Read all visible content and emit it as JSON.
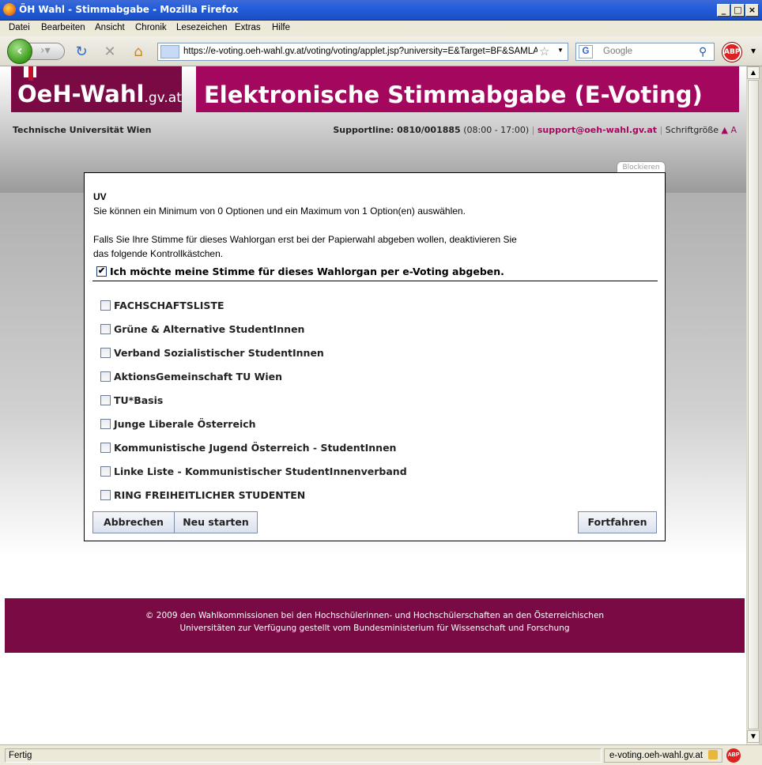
{
  "window": {
    "title": "ÖH Wahl - Stimmabgabe - Mozilla Firefox"
  },
  "menu": {
    "items": [
      "Datei",
      "Bearbeiten",
      "Ansicht",
      "Chronik",
      "Lesezeichen",
      "Extras",
      "Hilfe"
    ]
  },
  "toolbar": {
    "url": "https://e-voting.oeh-wahl.gv.at/voting/voting/applet.jsp?university=E&Target=BF&SAMLAr",
    "search_placeholder": "Google",
    "adblock_label": "ABP"
  },
  "header": {
    "logo_text": "OeH-Wahl",
    "logo_suffix": ".gv.at",
    "banner": "Elektronische Stimmabgabe (E-Voting)",
    "university": "Technische Universität Wien",
    "support_label": "Supportline: 0810/001885",
    "support_hours": "(08:00 - 17:00)",
    "support_sep1": "|",
    "support_email": "support@oeh-wahl.gv.at",
    "support_sep2": "|",
    "font_size_label": "Schriftgröße",
    "font_size_controls": "▲ A"
  },
  "panel": {
    "tab_label": "Blockieren",
    "title": "UV",
    "min_max_text": "Sie können ein Minimum von 0 Optionen und ein Maximum von 1 Option(en) auswählen.",
    "paper_text_1": "Falls Sie Ihre Stimme für dieses Wahlorgan erst bei der Papierwahl abgeben wollen, deaktivieren Sie",
    "paper_text_2": "das folgende Kontrollkästchen.",
    "confirm_label": "Ich möchte meine Stimme für dieses Wahlorgan per e-Voting abgeben.",
    "confirm_checked": true,
    "options": [
      "FACHSCHAFTSLISTE",
      "Grüne & Alternative StudentInnen",
      "Verband Sozialistischer StudentInnen",
      "AktionsGemeinschaft TU Wien",
      "TU*Basis",
      "Junge Liberale Österreich",
      "Kommunistische Jugend Österreich - StudentInnen",
      "Linke Liste - Kommunistischer StudentInnenverband",
      "RING FREIHEITLICHER STUDENTEN"
    ],
    "buttons": {
      "cancel": "Abbrechen",
      "restart": "Neu starten",
      "continue": "Fortfahren"
    }
  },
  "footer": {
    "line1": "© 2009 den Wahlkommissionen bei den Hochschülerinnen- und Hochschülerschaften an den Österreichischen",
    "line2": "Universitäten zur Verfügung gestellt vom Bundesministerium für Wissenschaft und Forschung"
  },
  "statusbar": {
    "status": "Fertig",
    "domain": "e-voting.oeh-wahl.gv.at",
    "adblock_label": "ABP"
  },
  "colors": {
    "brand": "#a3085e",
    "brand_dark": "#7a0a44",
    "titlebar": "#245edb"
  }
}
